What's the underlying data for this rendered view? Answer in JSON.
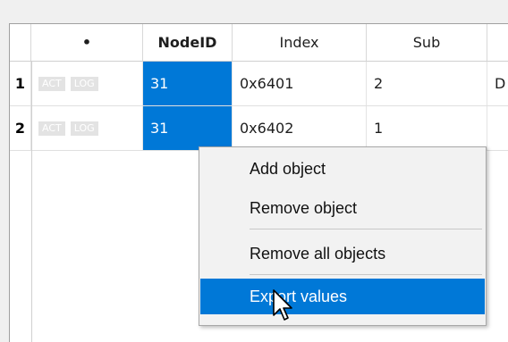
{
  "header": {
    "columns": [
      "",
      "•",
      "NodeID",
      "Index",
      "Sub",
      ""
    ]
  },
  "rows": [
    {
      "num": "1",
      "tags": [
        "ACT",
        "LOG"
      ],
      "node_id": "31",
      "index": "0x6401",
      "sub": "2",
      "extra": "D"
    },
    {
      "num": "2",
      "tags": [
        "ACT",
        "LOG"
      ],
      "node_id": "31",
      "index": "0x6402",
      "sub": "1",
      "extra": ""
    }
  ],
  "context_menu": {
    "items": [
      "Add object",
      "Remove object",
      "Remove all objects",
      "Export values"
    ],
    "highlighted": "Export values"
  },
  "colors": {
    "selection": "#0078d7",
    "tag_bg": "#e3e3e3"
  },
  "icons": {
    "cursor": "mouse-pointer-icon"
  }
}
